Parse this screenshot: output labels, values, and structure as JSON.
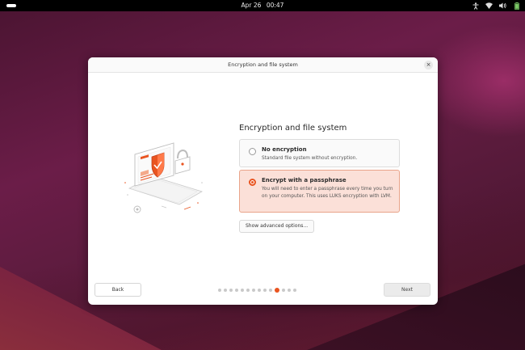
{
  "topbar": {
    "date": "Apr 26",
    "time": "00:47",
    "icons": [
      "accessibility-icon",
      "network-icon",
      "volume-icon",
      "battery-icon"
    ]
  },
  "dialog": {
    "title": "Encryption and file system",
    "close_glyph": "×",
    "heading": "Encryption and file system",
    "options": [
      {
        "title": "No encryption",
        "description": "Standard file system without encryption.",
        "selected": false
      },
      {
        "title": "Encrypt with a passphrase",
        "description": "You will need to enter a passphrase every time you turn on your computer. This uses LUKS encryption with LVM.",
        "selected": true
      }
    ],
    "advanced_label": "Show advanced options...",
    "back_label": "Back",
    "next_label": "Next",
    "progress": {
      "total_steps": 14,
      "current_step": 11
    }
  },
  "colors": {
    "accent": "#e95420",
    "selected_bg": "#fbe0d8"
  }
}
